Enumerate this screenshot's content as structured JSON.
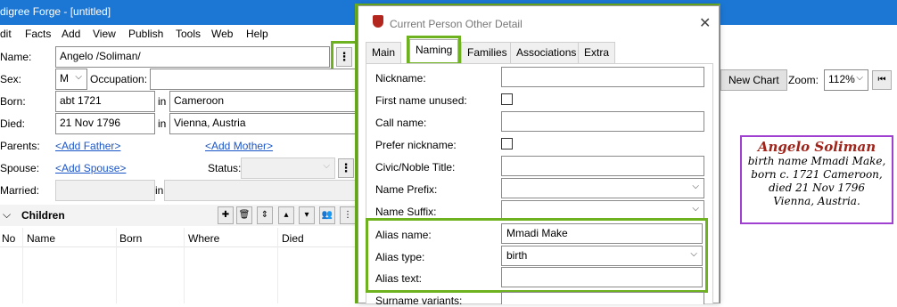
{
  "window": {
    "title": "digree Forge - [untitled]"
  },
  "menu": [
    "dit",
    "Facts",
    "Add",
    "View",
    "Publish",
    "Tools",
    "Web",
    "Help"
  ],
  "person": {
    "name_label": "Name:",
    "name_value": "Angelo /Soliman/",
    "sex_label": "Sex:",
    "sex_value": "M",
    "occupation_label": "Occupation:",
    "born_label": "Born:",
    "born_date": "abt 1721",
    "born_in": "in",
    "born_place": "Cameroon",
    "died_label": "Died:",
    "died_date": "21 Nov 1796",
    "died_in": "in",
    "died_place": "Vienna, Austria",
    "parents_label": "Parents:",
    "add_father": "<Add Father>",
    "add_mother": "<Add Mother>",
    "spouse_label": "Spouse:",
    "add_spouse": "<Add Spouse>",
    "status_label": "Status:",
    "married_label": "Married:",
    "married_in": "in"
  },
  "children": {
    "header": "Children",
    "columns": [
      "No",
      "Name",
      "Born",
      "Where",
      "Died"
    ]
  },
  "chart_toolbar": {
    "new_chart": "New Chart",
    "zoom_label": "Zoom:",
    "zoom_value": "112%"
  },
  "chart_box": {
    "name": "Angelo Soliman",
    "lines": [
      "birth name Mmadi Make,",
      "born c. 1721 Cameroon,",
      "died 21 Nov 1796",
      "Vienna, Austria."
    ]
  },
  "dialog": {
    "title": "Current Person Other Detail",
    "tabs": [
      "Main",
      "Naming",
      "Families",
      "Associations",
      "Extra"
    ],
    "active_tab": "Naming",
    "fields": {
      "nickname_label": "Nickname:",
      "first_name_unused_label": "First name unused:",
      "call_name_label": "Call name:",
      "prefer_nickname_label": "Prefer nickname:",
      "civic_title_label": "Civic/Noble Title:",
      "name_prefix_label": "Name Prefix:",
      "name_suffix_label": "Name Suffix:",
      "alias_name_label": "Alias name:",
      "alias_name_value": "Mmadi Make",
      "alias_type_label": "Alias type:",
      "alias_type_value": "birth",
      "alias_text_label": "Alias text:",
      "surname_variants_label": "Surname variants:"
    }
  },
  "colors": {
    "title_bar": "#1c77d4",
    "highlight": "#6fb21f",
    "link": "#1a55c8",
    "chart_name": "#a0241a",
    "chart_border": "#a040d0"
  }
}
